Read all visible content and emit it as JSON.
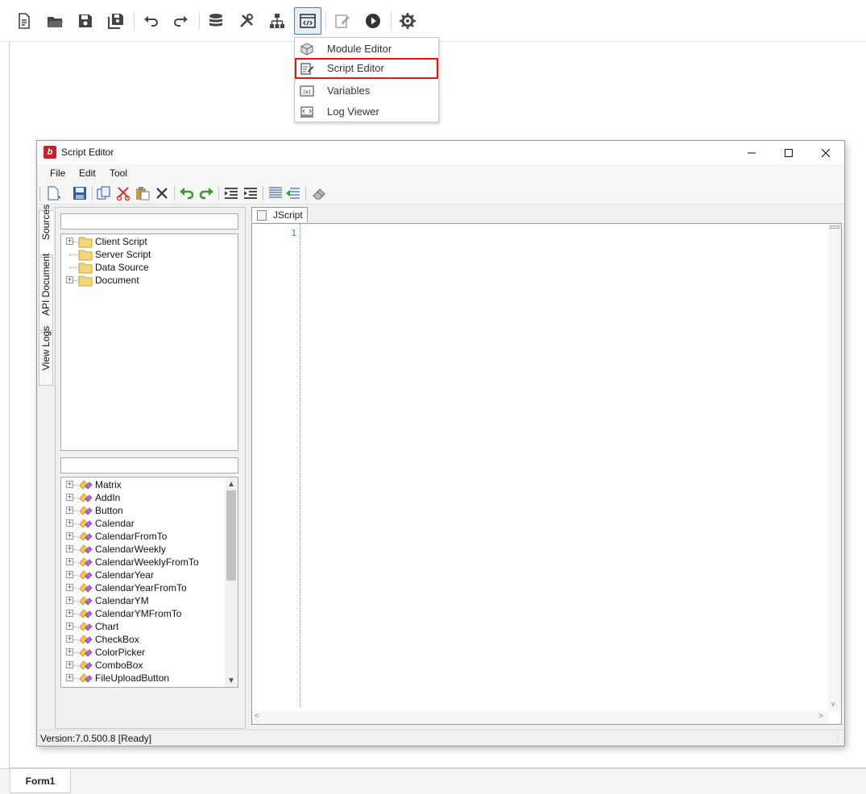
{
  "toolbar": {
    "buttons": [
      {
        "name": "new-document-icon"
      },
      {
        "name": "open-folder-icon"
      },
      {
        "name": "save-icon"
      },
      {
        "name": "save-all-icon"
      },
      {
        "name": "undo-icon"
      },
      {
        "name": "redo-icon"
      },
      {
        "name": "database-icon"
      },
      {
        "name": "tools-icon"
      },
      {
        "name": "hierarchy-icon"
      },
      {
        "name": "code-window-icon"
      },
      {
        "name": "edit-icon"
      },
      {
        "name": "run-icon"
      },
      {
        "name": "settings-gear-icon"
      }
    ],
    "active_button": "code-window-icon"
  },
  "dropdown_menu": {
    "items": [
      {
        "label": "Module Editor",
        "icon": "cube-icon"
      },
      {
        "label": "Script Editor",
        "icon": "script-edit-icon",
        "highlighted": true
      },
      {
        "label": "Variables",
        "icon": "variable-icon"
      },
      {
        "label": "Log Viewer",
        "icon": "log-viewer-icon"
      }
    ],
    "highlight_color": "#e0141e"
  },
  "script_editor": {
    "title": "Script Editor",
    "menu": [
      "File",
      "Edit",
      "Tool"
    ],
    "side_tabs": [
      "Sources",
      "API Document",
      "View Logs"
    ],
    "source_tree": [
      {
        "label": "Client Script",
        "expandable": true
      },
      {
        "label": "Server Script",
        "expandable": false
      },
      {
        "label": "Data Source",
        "expandable": false
      },
      {
        "label": "Document",
        "expandable": true
      }
    ],
    "component_tree": [
      "Matrix",
      "AddIn",
      "Button",
      "Calendar",
      "CalendarFromTo",
      "CalendarWeekly",
      "CalendarWeeklyFromTo",
      "CalendarYear",
      "CalendarYearFromTo",
      "CalendarYM",
      "CalendarYMFromTo",
      "Chart",
      "CheckBox",
      "ColorPicker",
      "ComboBox",
      "FileUploadButton"
    ],
    "document_tab": "JScript",
    "line_number": "1",
    "status": "Version:7.0.500.8  [Ready]"
  },
  "form_tab": "Form1",
  "colors": {
    "accent_active": "#4a78b8",
    "logo_red": "#c8222a"
  }
}
